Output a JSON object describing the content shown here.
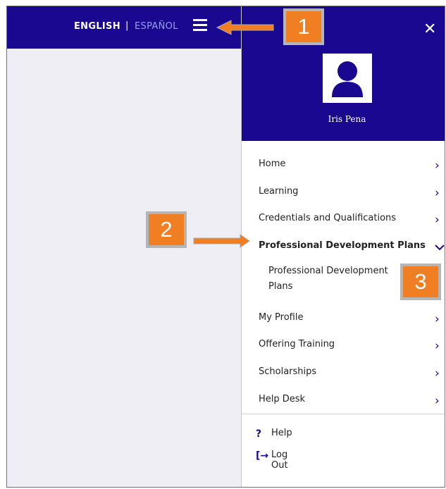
{
  "header": {
    "lang_english": "ENGLISH",
    "lang_separator": "|",
    "lang_spanish": "ESPAÑOL",
    "menu_icon": "hamburger-icon"
  },
  "drawer": {
    "close_icon": "close-icon",
    "user_name": "Iris Pena",
    "menu": [
      {
        "label": "Home"
      },
      {
        "label": "Learning"
      },
      {
        "label": "Credentials and Qualifications"
      },
      {
        "label": "Professional Development Plans",
        "expanded": true
      },
      {
        "label": "My Profile"
      },
      {
        "label": "Offering Training"
      },
      {
        "label": "Scholarships"
      },
      {
        "label": "Help Desk"
      }
    ],
    "submenu": [
      {
        "label": "Professional Development Plans"
      }
    ],
    "footer": [
      {
        "icon": "help-icon",
        "label": "Help"
      },
      {
        "icon": "logout-icon",
        "label": "Log Out"
      }
    ]
  },
  "annotations": {
    "callout_1": "1",
    "callout_2": "2",
    "callout_3": "3"
  },
  "colors": {
    "brand": "#1a0891",
    "accent": "#ef7f22",
    "spanish_link": "#9a9cf4"
  }
}
